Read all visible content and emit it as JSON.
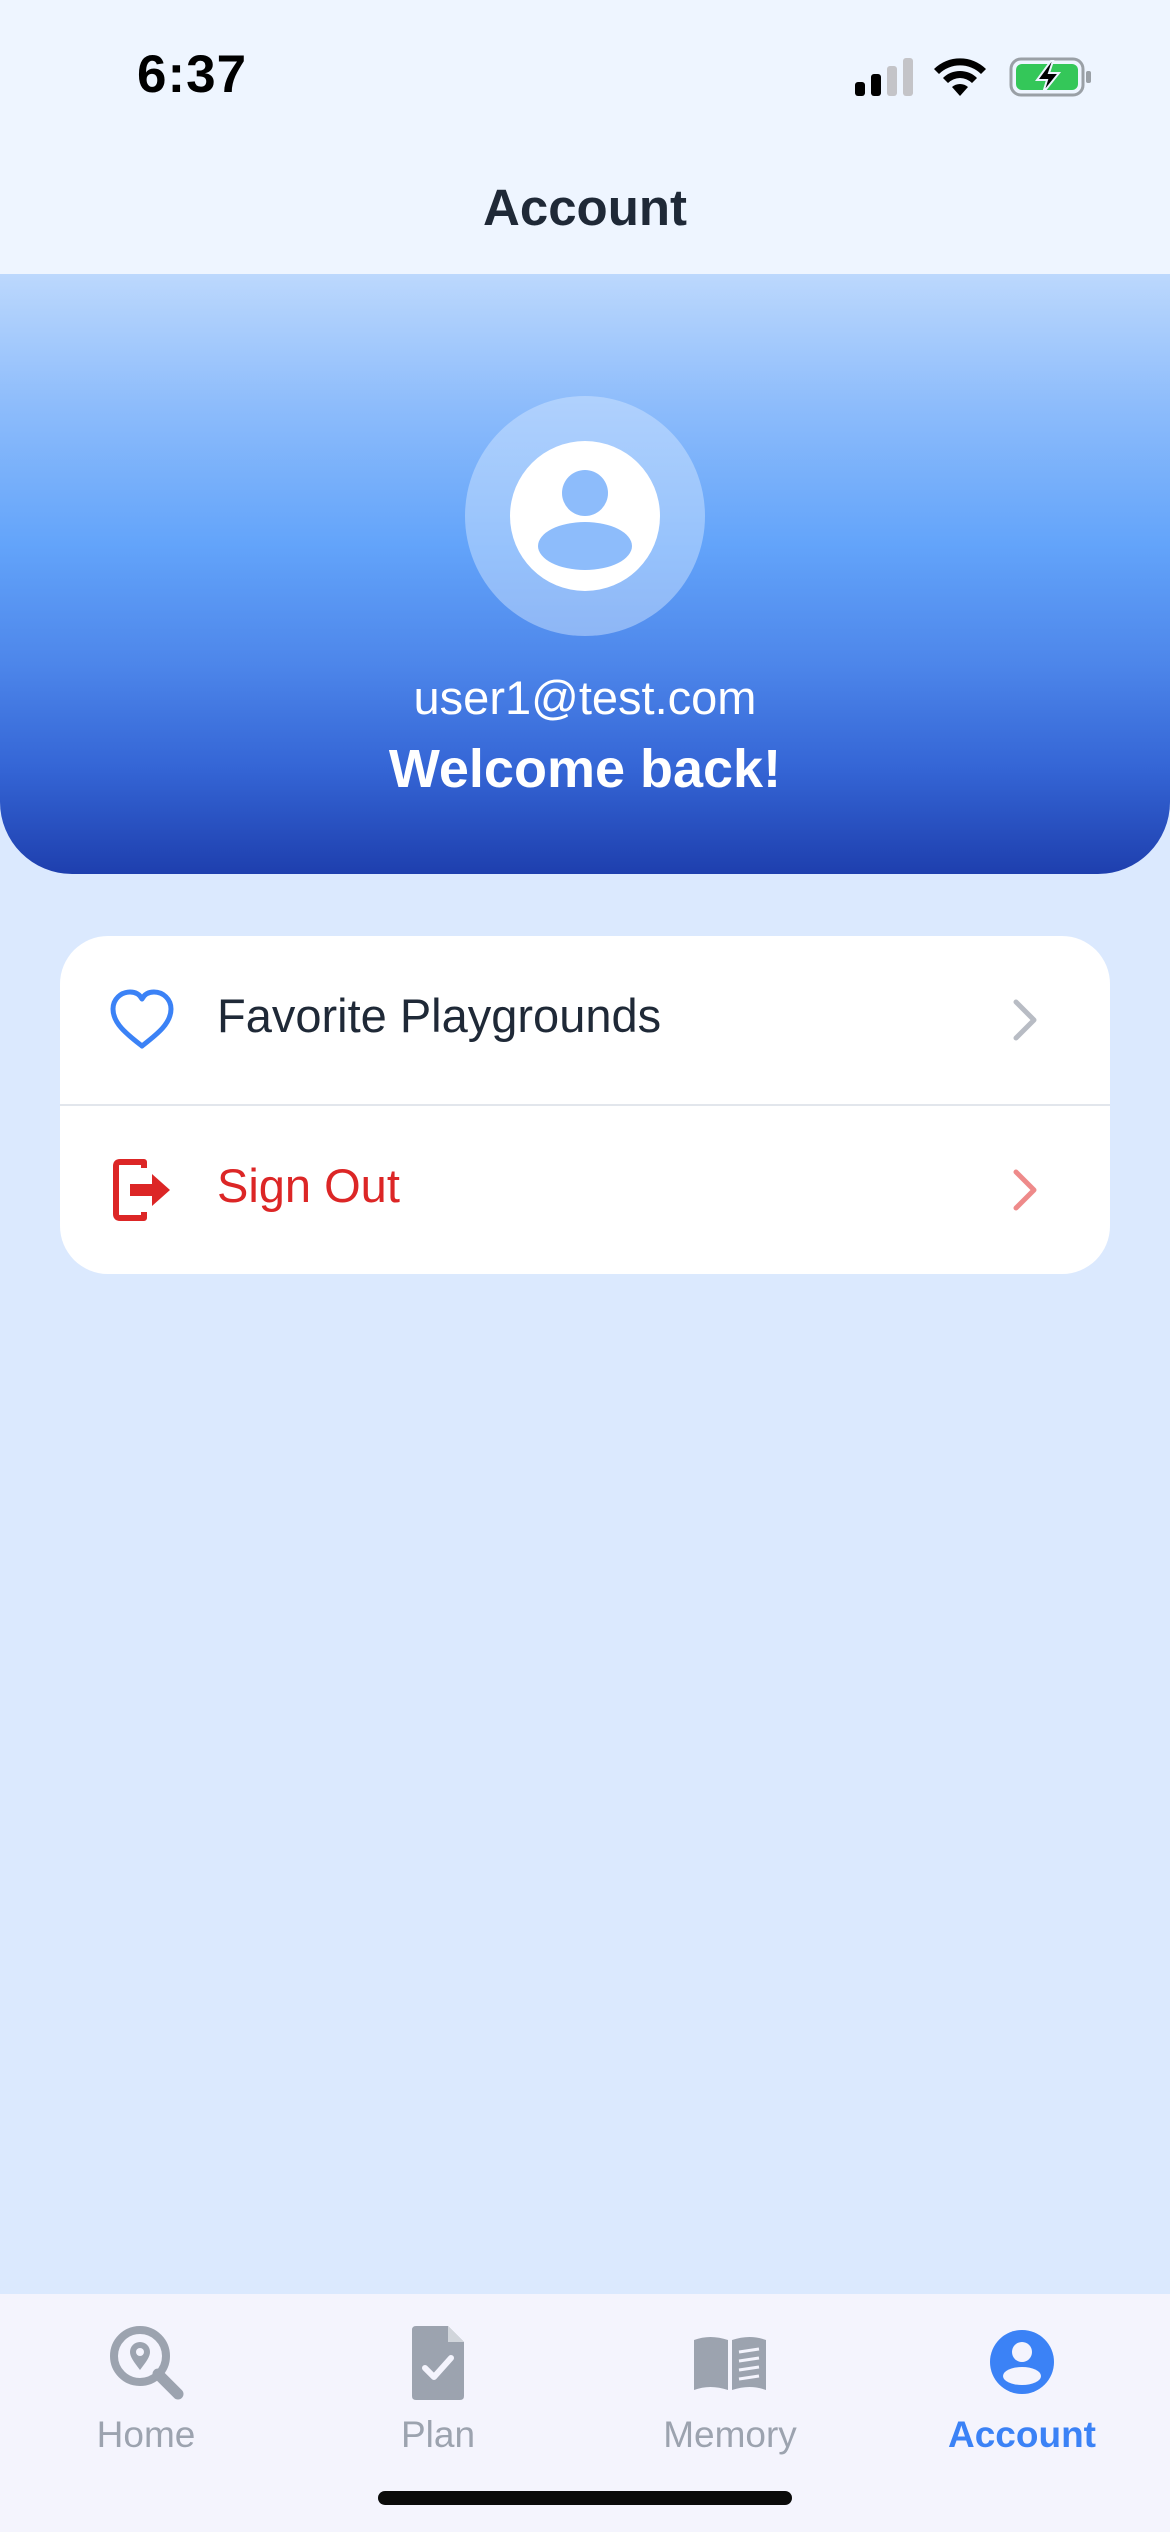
{
  "status_bar": {
    "time": "6:37",
    "icons": [
      "signal-icon",
      "wifi-icon",
      "battery-charging-icon"
    ]
  },
  "header": {
    "title": "Account"
  },
  "profile": {
    "email": "user1@test.com",
    "greeting": "Welcome back!",
    "avatar_icon": "person-circle-icon"
  },
  "menu": {
    "items": [
      {
        "label": "Favorite Playgrounds",
        "icon": "heart-icon",
        "color": "#1f2937",
        "icon_color": "#3b82f6"
      },
      {
        "label": "Sign Out",
        "icon": "sign-out-icon",
        "color": "#dc2626",
        "icon_color": "#dc2626"
      }
    ]
  },
  "tab_bar": {
    "tabs": [
      {
        "label": "Home",
        "icon": "search-location-icon",
        "active": false
      },
      {
        "label": "Plan",
        "icon": "document-check-icon",
        "active": false
      },
      {
        "label": "Memory",
        "icon": "book-open-icon",
        "active": false
      },
      {
        "label": "Account",
        "icon": "account-circle-icon",
        "active": true
      }
    ]
  },
  "colors": {
    "accent": "#3b82f6",
    "danger": "#dc2626",
    "background": "#dbe9fe",
    "inactive_tab": "#9ca3af"
  }
}
